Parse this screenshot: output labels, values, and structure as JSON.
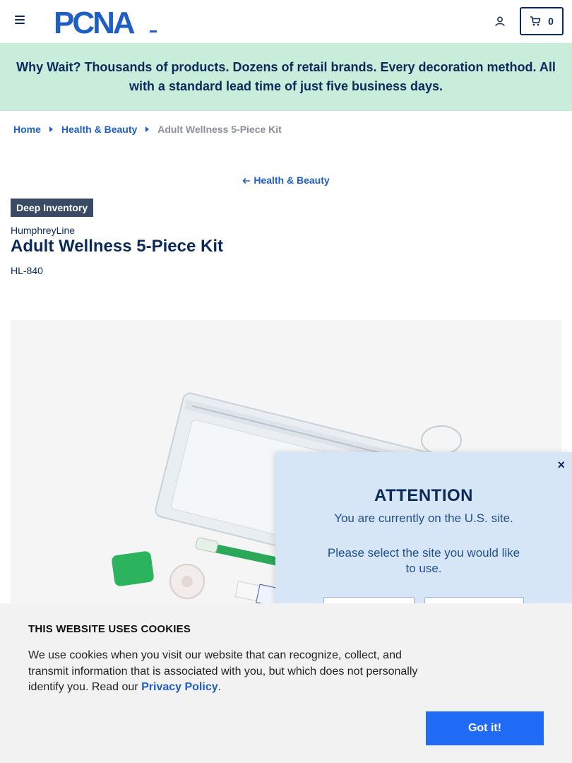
{
  "header": {
    "logo_text": "PCNA",
    "cart_count": "0"
  },
  "promo": {
    "text": "Why Wait? Thousands of products. Dozens of retail brands. Every decoration method. All with a standard lead time of just five business days."
  },
  "breadcrumb": {
    "items": [
      "Home",
      "Health & Beauty"
    ],
    "current": "Adult Wellness 5-Piece Kit"
  },
  "back_link": {
    "label": "Health & Beauty"
  },
  "product": {
    "badge": "Deep Inventory",
    "brand": "HumphreyLine",
    "title": "Adult Wellness 5-Piece Kit",
    "sku": "HL-840"
  },
  "attention": {
    "close_label": "×",
    "title": "ATTENTION",
    "message": "You are currently on the U.S. site.",
    "prompt": "Please select the site you would like to use."
  },
  "cookie": {
    "title": "THIS WEBSITE USES COOKIES",
    "text_before": "We use cookies when you visit our website that can recognize, collect, and transmit information that is associated with you, but which does not personally identify you. Read our ",
    "link_label": "Privacy Policy",
    "text_after": ".",
    "button_label": "Got it!"
  },
  "colors": {
    "navy": "#0b2a5b",
    "link_blue": "#1f5fc4",
    "promo_bg": "#c8eedb",
    "modal_bg": "#d6e6f7",
    "cookie_button": "#1f6bf5"
  },
  "icons": [
    "menu-icon",
    "user-icon",
    "cart-icon",
    "chevron-right-icon",
    "arrow-left-icon",
    "close-icon"
  ]
}
